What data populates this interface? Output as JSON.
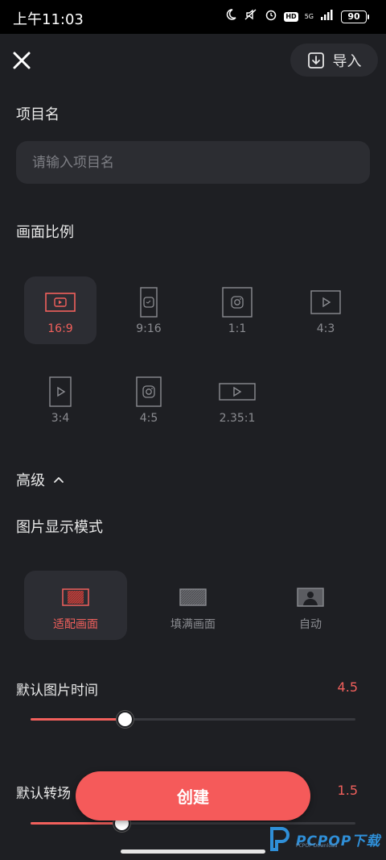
{
  "status_bar": {
    "time": "上午11:03",
    "network": "5G",
    "hd": "HD",
    "battery": "90"
  },
  "header": {
    "import_label": "导入"
  },
  "project_name": {
    "title": "项目名",
    "placeholder": "请输入项目名",
    "value": ""
  },
  "aspect_ratio": {
    "title": "画面比例",
    "selected": "16:9",
    "options": [
      {
        "label": "16:9",
        "icon": "youtube-icon"
      },
      {
        "label": "9:16",
        "icon": "vertical-video-icon"
      },
      {
        "label": "1:1",
        "icon": "instagram-icon"
      },
      {
        "label": "4:3",
        "icon": "play-icon"
      },
      {
        "label": "3:4",
        "icon": "play-icon"
      },
      {
        "label": "4:5",
        "icon": "instagram-icon"
      },
      {
        "label": "2.35:1",
        "icon": "play-icon"
      }
    ]
  },
  "advanced": {
    "title": "高级",
    "expanded": true
  },
  "display_mode": {
    "title": "图片显示模式",
    "selected": "适配画面",
    "options": [
      {
        "label": "适配画面",
        "icon": "fit-icon"
      },
      {
        "label": "填满画面",
        "icon": "fill-icon"
      },
      {
        "label": "自动",
        "icon": "auto-icon"
      }
    ]
  },
  "image_duration": {
    "label": "默认图片时间",
    "value": "4.5",
    "fraction": 0.29
  },
  "transition": {
    "label": "默认转场",
    "value": "1.5",
    "fraction": 0.28
  },
  "create_label": "创建",
  "watermark": {
    "text": "PCPOP下载",
    "sub": "PCPOP Download"
  },
  "colors": {
    "accent": "#f2605c",
    "button": "#f55a5a",
    "background": "#1e1f23",
    "surface": "#2c2d32"
  }
}
